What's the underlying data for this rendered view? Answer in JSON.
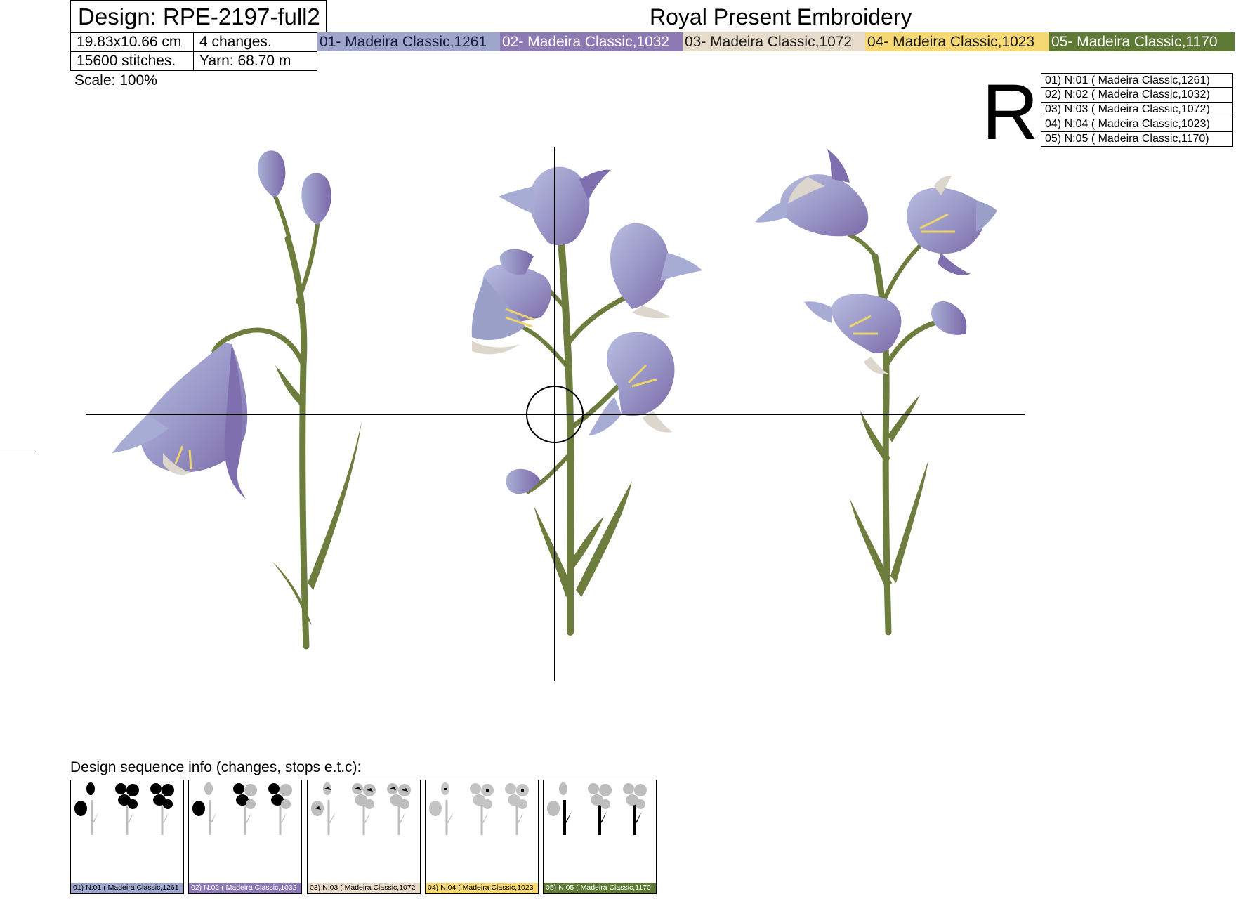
{
  "header": {
    "design_title": "Design: RPE-2197-full2",
    "dimensions": "19.83x10.66 cm",
    "changes": "4 changes.",
    "stitches": "15600 stitches.",
    "yarn": "Yarn: 68.70 m",
    "brand": "Royal Present Embroidery",
    "scale": "Scale: 100%"
  },
  "threads": [
    {
      "label": "01- Madeira Classic,1261",
      "color": "#9ea6cc",
      "text_color": "#1a1a3a"
    },
    {
      "label": "02- Madeira Classic,1032",
      "color": "#8d7ab4",
      "text_color": "#ffffff"
    },
    {
      "label": "03- Madeira Classic,1072",
      "color": "#e6dcc9",
      "text_color": "#1a1a1a"
    },
    {
      "label": "04- Madeira Classic,1023",
      "color": "#f6d874",
      "text_color": "#1a1a1a"
    },
    {
      "label": "05- Madeira Classic,1170",
      "color": "#5f7a35",
      "text_color": "#ffffff"
    }
  ],
  "orientation_mark": "R",
  "legend": [
    "01) N:01 ( Madeira Classic,1261)",
    "02) N:02 ( Madeira Classic,1032)",
    "03) N:03 ( Madeira Classic,1072)",
    "04) N:04 ( Madeira Classic,1023)",
    "05) N:05 ( Madeira Classic,1170)"
  ],
  "sequence": {
    "label": "Design sequence info (changes, stops e.t.c):",
    "steps": [
      {
        "caption": "01) N:01 ( Madeira Classic,1261",
        "color": "#9ea6cc",
        "active": "flowers"
      },
      {
        "caption": "02) N:02 ( Madeira Classic,1032",
        "color": "#8d7ab4",
        "active": "flowers-partial"
      },
      {
        "caption": "03) N:03 ( Madeira Classic,1072",
        "color": "#e6dcc9",
        "active": "highlights"
      },
      {
        "caption": "04) N:04 ( Madeira Classic,1023",
        "color": "#f6d874",
        "active": "stamens"
      },
      {
        "caption": "05) N:05 ( Madeira Classic,1170",
        "color": "#5f7a35",
        "active": "stems"
      }
    ]
  },
  "colors": {
    "stem": "#6d7d3e",
    "petal_main": "#9aa0c8",
    "petal_dark": "#7f6fae",
    "petal_light": "#ddd6cc",
    "stamen": "#eed36a"
  }
}
